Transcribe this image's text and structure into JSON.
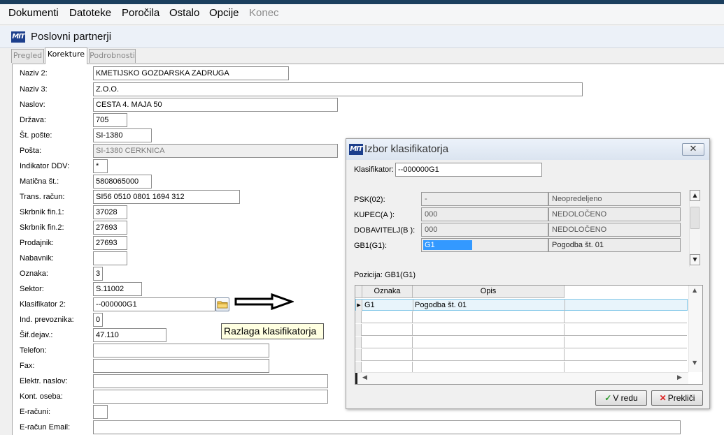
{
  "menu": {
    "items": [
      "Dokumenti",
      "Datoteke",
      "Poročila",
      "Ostalo",
      "Opcije",
      "Konec"
    ]
  },
  "window": {
    "logo": "MIT",
    "title": "Poslovni partnerji",
    "tabs": [
      "Pregled",
      "Korekture",
      "Podrobnosti"
    ]
  },
  "form": {
    "rows": [
      {
        "label": "Naziv 2:",
        "value": "KMETIJSKO GOZDARSKA ZADRUGA"
      },
      {
        "label": "Naziv 3:",
        "value": "Z.O.O."
      },
      {
        "label": "Naslov:",
        "value": "CESTA 4. MAJA 50"
      },
      {
        "label": "Država:",
        "value": "705"
      },
      {
        "label": "Št. pošte:",
        "value": "SI-1380"
      },
      {
        "label": "Pošta:",
        "value": "SI-1380 CERKNICA"
      },
      {
        "label": "Indikator DDV:",
        "value": "*"
      },
      {
        "label": "Matična št.:",
        "value": "5808065000"
      },
      {
        "label": "Trans. račun:",
        "value": "SI56 0510 0801 1694 312"
      },
      {
        "label": "Skrbnik fin.1:",
        "value": "37028"
      },
      {
        "label": "Skrbnik fin.2:",
        "value": "27693"
      },
      {
        "label": "Prodajnik:",
        "value": "27693"
      },
      {
        "label": "Nabavnik:",
        "value": ""
      },
      {
        "label": "Oznaka:",
        "value": "3"
      },
      {
        "label": "Sektor:",
        "value": "S.11002"
      },
      {
        "label": "Klasifikator 2:",
        "value": "--000000G1"
      },
      {
        "label": "Ind. prevoznika:",
        "value": "0"
      },
      {
        "label": "Šif.dejav.:",
        "value": "47.110"
      },
      {
        "label": "Telefon:",
        "value": ""
      },
      {
        "label": "Fax:",
        "value": ""
      },
      {
        "label": "Elektr. naslov:",
        "value": ""
      },
      {
        "label": "Kont. oseba:",
        "value": ""
      },
      {
        "label": "E-računi:",
        "value": ""
      },
      {
        "label": "E-račun Email:",
        "value": ""
      }
    ],
    "tooltip": "Razlaga klasifikatorja"
  },
  "dialog": {
    "logo": "MIT",
    "title": "Izbor klasifikatorja",
    "close_icon": "close-icon",
    "klasifikator_label": "Klasifikator:",
    "klasifikator_value": "--000000G1",
    "levels": [
      {
        "label": "PSK(02):",
        "code": "-",
        "desc": "Neopredeljeno"
      },
      {
        "label": "KUPEC(A ):",
        "code": "000",
        "desc": "NEDOLOČENO"
      },
      {
        "label": "DOBAVITELJ(B ):",
        "code": "000",
        "desc": "NEDOLOČENO"
      },
      {
        "label": "GB1(G1):",
        "code": "G1",
        "desc": "Pogodba št. 01"
      }
    ],
    "pozicija_label": "Pozicija: GB1(G1)",
    "grid": {
      "headers": [
        "Oznaka",
        "Opis"
      ],
      "rows": [
        {
          "oznaka": "G1",
          "opis": "Pogodba št. 01"
        }
      ]
    },
    "ok_label": "V redu",
    "cancel_label": "Prekliči",
    "accent_color": "#3399ff"
  }
}
